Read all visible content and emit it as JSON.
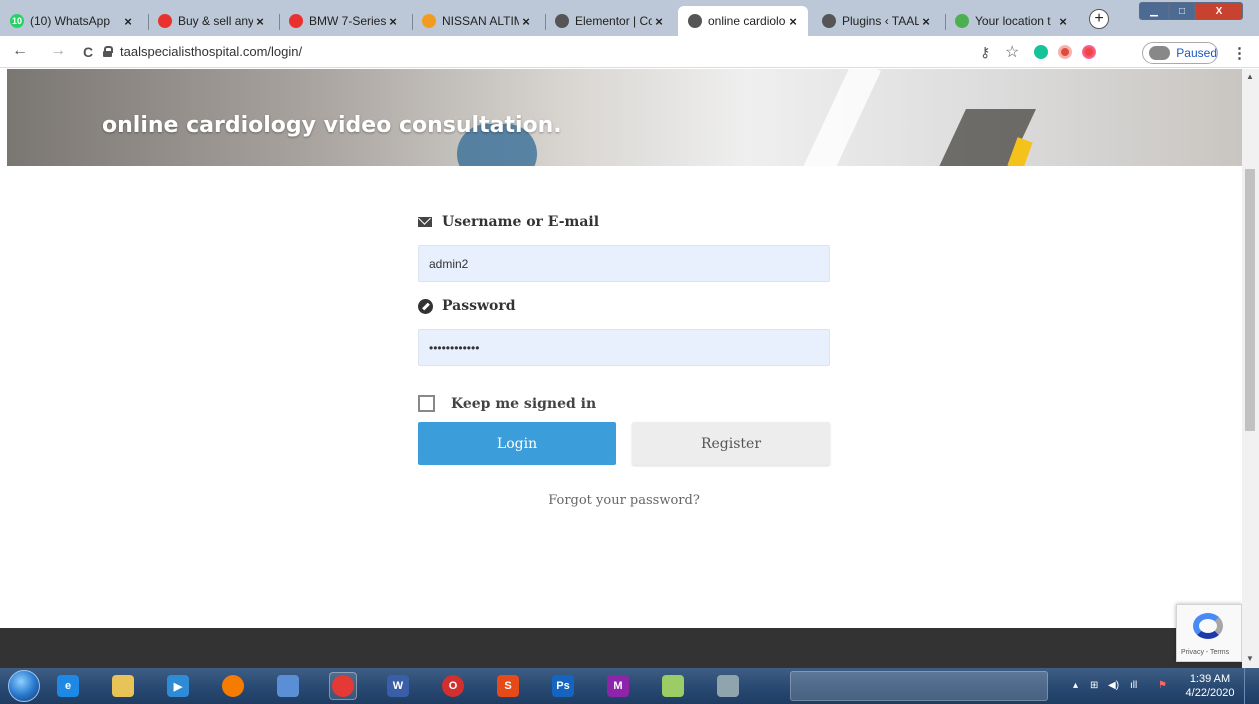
{
  "tabs": [
    {
      "label": "(10) WhatsApp",
      "icon": "whatsapp-icon",
      "color": "#25d366",
      "badge": "10"
    },
    {
      "label": "Buy & sell any",
      "icon": "olx-icon",
      "color": "#e9322d"
    },
    {
      "label": "BMW 7-Series",
      "icon": "olx-icon",
      "color": "#e9322d"
    },
    {
      "label": "NISSAN ALTIM",
      "icon": "pakwheels-icon",
      "color": "#f29c1f"
    },
    {
      "label": "Elementor | Co",
      "icon": "globe-icon",
      "color": "#555555"
    },
    {
      "label": "online cardiolo",
      "icon": "globe-icon",
      "color": "#555555",
      "active": true
    },
    {
      "label": "Plugins ‹ TAAL",
      "icon": "globe-icon",
      "color": "#555555"
    },
    {
      "label": "Your location t",
      "icon": "maps-pin-icon",
      "color": "#4caf50"
    }
  ],
  "close_glyph": "×",
  "new_tab_glyph": "+",
  "window_controls": {
    "minimize": "▁",
    "maximize": "□",
    "close": "X"
  },
  "toolbar": {
    "back": "←",
    "forward": "→",
    "reload": "C",
    "url": "taalspecialisthospital.com/login/",
    "paused_label": "Paused",
    "menu": "⋮",
    "key": "⚷",
    "star": "☆"
  },
  "hero": {
    "title": "online cardiology video consultation."
  },
  "login": {
    "username_label": "Username or E-mail",
    "username_value": "admin2",
    "password_label": "Password",
    "password_value": "••••••••••••",
    "remember_label": "Keep me signed in",
    "login_button": "Login",
    "register_button": "Register",
    "forgot_link": "Forgot your password?"
  },
  "recaptcha": {
    "text": "Privacy - Terms"
  },
  "scrollbar": {
    "up": "▲",
    "down": "▼"
  },
  "taskbar": {
    "apps": [
      {
        "name": "internet-explorer-icon",
        "color": "#1e88e5",
        "glyph": "e"
      },
      {
        "name": "file-explorer-icon",
        "color": "#e8c458",
        "glyph": ""
      },
      {
        "name": "media-player-icon",
        "color": "#2e8bd6",
        "glyph": "▶"
      },
      {
        "name": "firefox-icon",
        "color": "#f57c00",
        "glyph": ""
      },
      {
        "name": "app-blue-icon",
        "color": "#5a8fd6",
        "glyph": ""
      },
      {
        "name": "chrome-icon",
        "color": "#e53935",
        "glyph": ""
      },
      {
        "name": "word-icon",
        "color": "#3b5ea8",
        "glyph": "W"
      },
      {
        "name": "opera-icon",
        "color": "#d32f2f",
        "glyph": "O"
      },
      {
        "name": "app-swirl-icon",
        "color": "#e64a19",
        "glyph": "S"
      },
      {
        "name": "photoshop-icon",
        "color": "#1565c0",
        "glyph": "Ps"
      },
      {
        "name": "app-m-icon",
        "color": "#8e24aa",
        "glyph": "M"
      },
      {
        "name": "sticky-notes-icon",
        "color": "#9ccc65",
        "glyph": ""
      },
      {
        "name": "app-tool-icon",
        "color": "#90a4ae",
        "glyph": ""
      }
    ],
    "tray": {
      "arrow": "▴",
      "network": "⊞",
      "volume": "◀)",
      "signal": "ıll",
      "flag": "⚑"
    },
    "time": "1:39 AM",
    "date": "4/22/2020"
  }
}
